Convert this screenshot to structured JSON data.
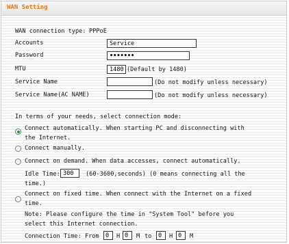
{
  "title": "WAN Setting",
  "wan_type": {
    "label": "WAN connection type:",
    "value": "PPPoE"
  },
  "accounts": {
    "label": "Accounts",
    "value": "Service"
  },
  "password": {
    "label": "Password",
    "value": "•••••••"
  },
  "mtu": {
    "label": "MTU",
    "value": "1480",
    "hint": "(Default by 1480)"
  },
  "service_name": {
    "label": "Service Name",
    "value": "",
    "hint": "(Do not modify unless necessary)"
  },
  "ac_name": {
    "label": "Service Name(AC NAME)",
    "value": "",
    "hint": "(Do not modify unless necessary)"
  },
  "mode_intro": "In terms of your needs, select connection mode:",
  "modes": {
    "auto": {
      "line1": "Connect automatically. When starting PC and disconnecting with",
      "line2": "the Internet.",
      "checked": true
    },
    "manual": {
      "line1": "Connect manually.",
      "checked": false
    },
    "demand": {
      "line1": "Connect on demand. When data accesses, connect automatically.",
      "checked": false
    },
    "fixed": {
      "line1": "Connect on fixed time. When connect with the Internet on a fixed",
      "line2": "time.",
      "checked": false
    }
  },
  "idle": {
    "label": "Idle Time:",
    "value": "300",
    "hint_line1": "(60-3600,seconds) (0 means connecting all the",
    "hint_line2": "time.)"
  },
  "note": {
    "line1": "Note: Please configure the time in \"System Tool\" before you",
    "line2": "select this Internet connection."
  },
  "conn_time": {
    "label": "Connection Time: From",
    "from_h": "0",
    "h1": "H",
    "from_m": "0",
    "m1": "M",
    "to": "to",
    "to_h": "0",
    "h2": "H",
    "to_m": "0",
    "m2": "M"
  }
}
